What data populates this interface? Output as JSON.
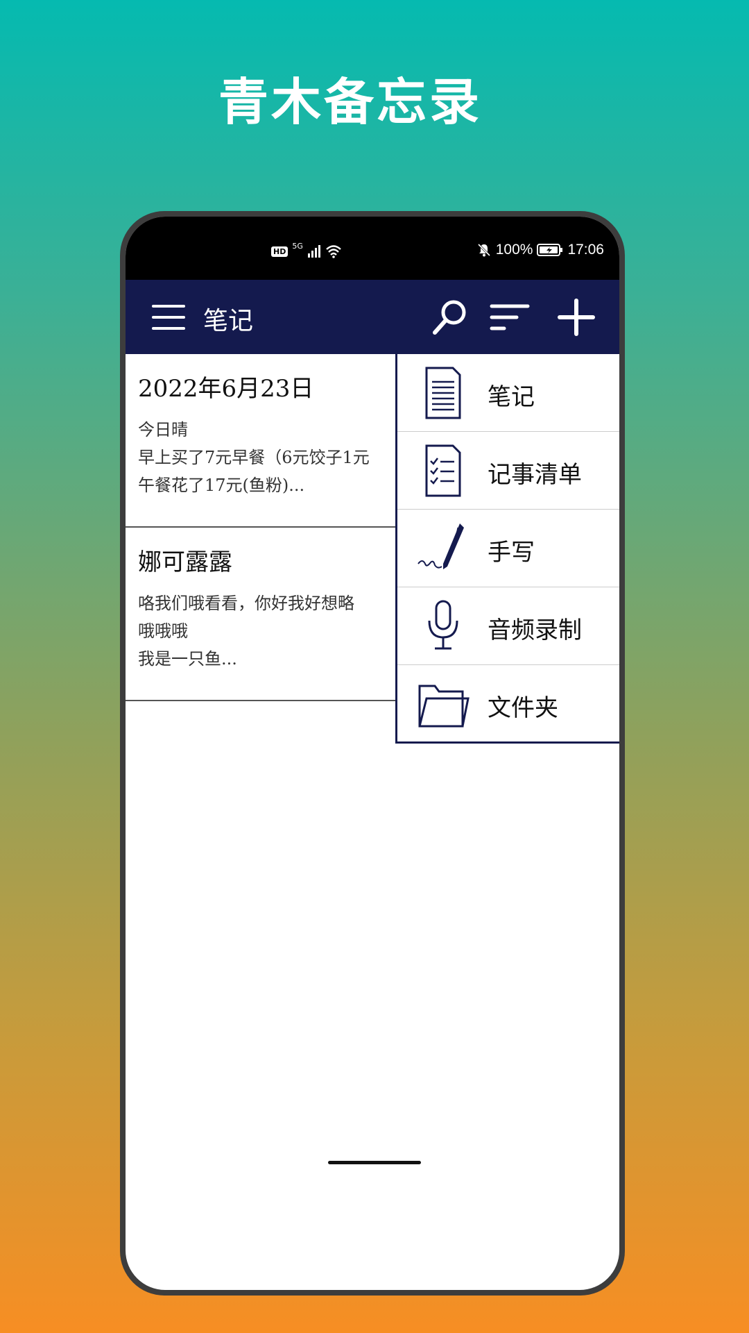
{
  "promo": {
    "title": "青木备忘录"
  },
  "status_bar": {
    "hd": "HD",
    "network": "5G",
    "battery": "100%",
    "time": "17:06"
  },
  "app_bar": {
    "title": "笔记",
    "actions": [
      "search-icon",
      "sort-icon",
      "add-icon"
    ]
  },
  "notes": [
    {
      "title": "2022年6月23日",
      "lines": [
        "今日晴",
        "早上买了7元早餐（6元饺子1元",
        "午餐花了17元(鱼粉)..."
      ]
    },
    {
      "title": "娜可露露",
      "lines": [
        "咯我们哦看看，你好我好想略",
        "哦哦哦",
        "我是一只鱼..."
      ]
    }
  ],
  "add_menu": {
    "items": [
      {
        "label": "笔记",
        "icon": "document-icon"
      },
      {
        "label": "记事清单",
        "icon": "checklist-icon"
      },
      {
        "label": "手写",
        "icon": "pen-icon"
      },
      {
        "label": "音频录制",
        "icon": "microphone-icon"
      },
      {
        "label": "文件夹",
        "icon": "folder-icon"
      }
    ]
  },
  "colors": {
    "app_bar": "#141a4e",
    "gradient_top": "#05bab0",
    "gradient_bottom": "#f78e23"
  }
}
